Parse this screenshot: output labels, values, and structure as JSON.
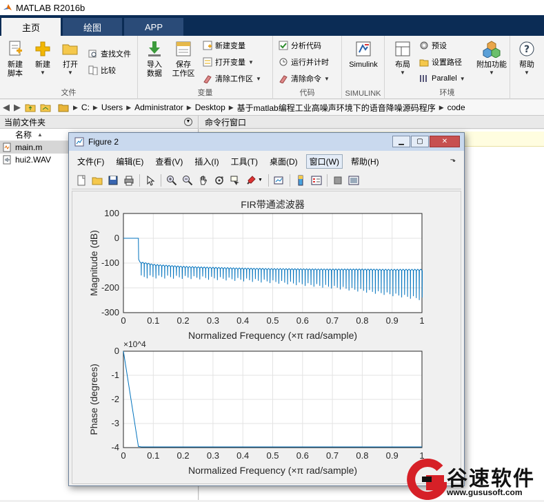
{
  "app": {
    "title": "MATLAB R2016b"
  },
  "tabs": [
    {
      "label": "主页",
      "active": true
    },
    {
      "label": "绘图",
      "active": false
    },
    {
      "label": "APP",
      "active": false
    }
  ],
  "ribbon": {
    "file": {
      "group": "文件",
      "new_script": "新建\n脚本",
      "new": "新建",
      "open": "打开",
      "find_files": "查找文件",
      "compare": "比较"
    },
    "variable": {
      "group": "变量",
      "import": "导入\n数据",
      "save_ws": "保存\n工作区",
      "new_var": "新建变量",
      "open_var": "打开变量",
      "clear_ws": "清除工作区"
    },
    "code": {
      "group": "代码",
      "analyze": "分析代码",
      "run_time": "运行并计时",
      "clear_cmds": "清除命令"
    },
    "simulink": {
      "group": "SIMULINK",
      "label": "Simulink"
    },
    "env": {
      "group": "环境",
      "layout": "布局",
      "prefs": "预设",
      "set_path": "设置路径",
      "parallel": "Parallel",
      "addons": "附加功能",
      "help": "帮助"
    }
  },
  "address": {
    "crumbs": [
      "C:",
      "Users",
      "Administrator",
      "Desktop",
      "基于matlab编程工业高噪声环境下的语音降噪源码程序",
      "code"
    ]
  },
  "current_folder": {
    "title": "当前文件夹",
    "col_name": "名称",
    "col_sort": "▲",
    "files": [
      {
        "name": "main.m",
        "selected": true
      },
      {
        "name": "hui2.WAV",
        "selected": false
      }
    ]
  },
  "command_window": {
    "title": "命令行窗口"
  },
  "figure": {
    "title": "Figure 2",
    "menus": [
      "文件(F)",
      "编辑(E)",
      "查看(V)",
      "插入(I)",
      "工具(T)",
      "桌面(D)",
      "窗口(W)",
      "帮助(H)"
    ],
    "active_menu": "窗口(W)"
  },
  "chart_data": [
    {
      "type": "line",
      "title": "FIR带通滤波器",
      "xlabel": "Normalized Frequency  (×π rad/sample)",
      "ylabel": "Magnitude (dB)",
      "xlim": [
        0,
        1
      ],
      "ylim": [
        -300,
        100
      ],
      "xticks": [
        "0",
        "0.1",
        "0.2",
        "0.3",
        "0.4",
        "0.5",
        "0.6",
        "0.7",
        "0.8",
        "0.9",
        "1"
      ],
      "yticks": [
        "100",
        "0",
        "-100",
        "-200",
        "-300"
      ],
      "grid": true,
      "color": "#0072bd",
      "series": [
        {
          "x": [
            0,
            0.05,
            0.051,
            0.055,
            0.08,
            0.1,
            0.2,
            0.3,
            0.4,
            0.5,
            0.6,
            0.7,
            0.8,
            0.9,
            1.0
          ],
          "y": [
            0,
            0,
            -85,
            -100,
            -105,
            -110,
            -118,
            -122,
            -125,
            -127,
            -128,
            -129,
            -129,
            -130,
            -130
          ],
          "notch_depth_min": -150,
          "notch_depth_max": -240
        }
      ]
    },
    {
      "type": "line",
      "xlabel": "Normalized Frequency  (×π rad/sample)",
      "ylabel": "Phase (degrees)",
      "multiplier": "×10^4",
      "xlim": [
        0,
        1
      ],
      "ylim": [
        -40000,
        0
      ],
      "xticks": [
        "0",
        "0.1",
        "0.2",
        "0.3",
        "0.4",
        "0.5",
        "0.6",
        "0.7",
        "0.8",
        "0.9",
        "1"
      ],
      "yticks": [
        "0",
        "-1",
        "-2",
        "-3",
        "-4"
      ],
      "grid": true,
      "color": "#0072bd",
      "series": [
        {
          "x": [
            0,
            0.05,
            0.06,
            1.0
          ],
          "y": [
            0,
            -39500,
            -39700,
            -39700
          ]
        }
      ]
    }
  ],
  "watermark": {
    "brand": "谷速软件",
    "url": "www.gususoft.com"
  }
}
